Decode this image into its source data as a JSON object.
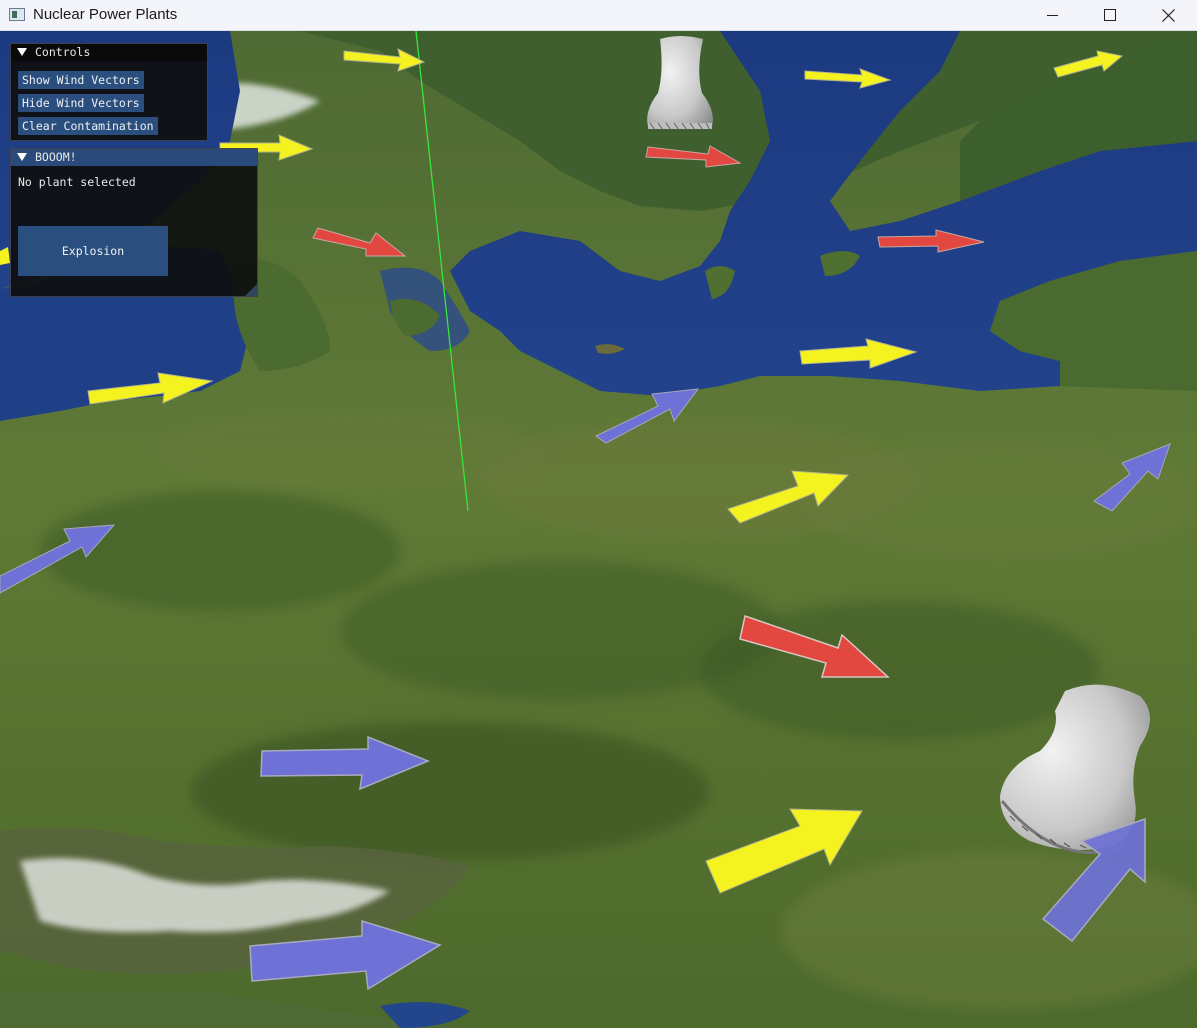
{
  "window": {
    "title": "Nuclear Power Plants"
  },
  "panels": {
    "controls": {
      "title": "Controls",
      "buttons": [
        "Show Wind Vectors",
        "Hide Wind Vectors",
        "Clear Contamination"
      ]
    },
    "booom": {
      "title": "BOOOM!",
      "status": "No plant selected",
      "explosion_label": "Explosion"
    }
  },
  "icons": {
    "collapse": "triangle-down-icon",
    "minimize": "minimize-icon",
    "maximize": "maximize-icon",
    "close": "close-icon",
    "app": "app-window-icon"
  },
  "colors": {
    "wind_yellow": "#f4f21f",
    "wind_red": "#e2483f",
    "wind_blue": "#6e71d6",
    "button_blue": "#2a4f7e",
    "panel_title_active": "#294a7a",
    "marker_line": "#36e63a",
    "sea": "#1f3d86"
  }
}
